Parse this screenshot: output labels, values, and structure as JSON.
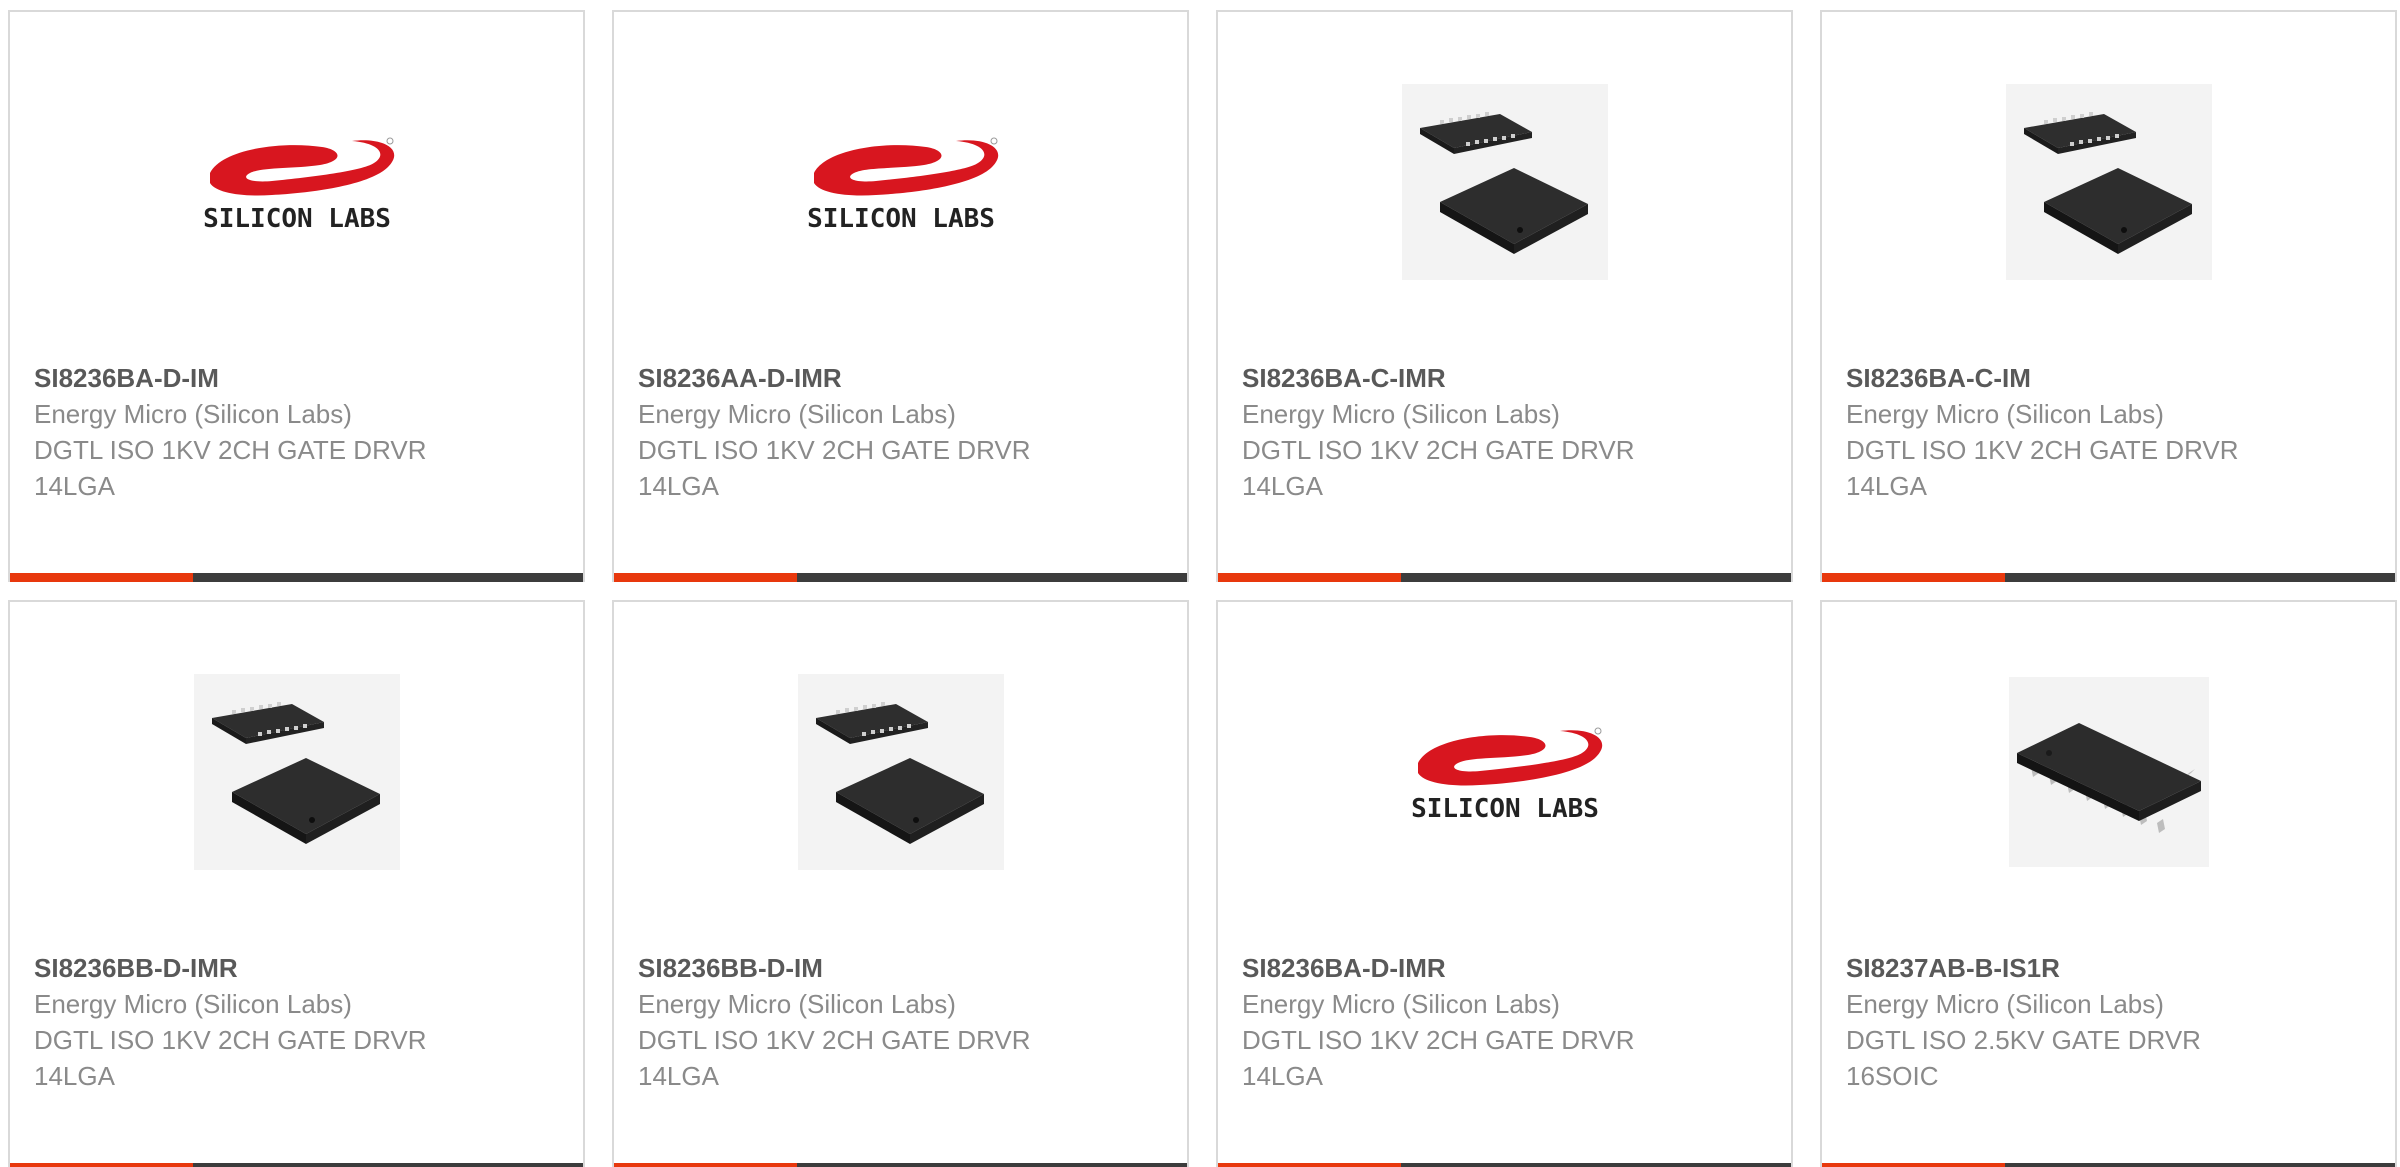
{
  "colors": {
    "accent": "#e8380d",
    "bar": "#3c3c3c",
    "part_text": "#595959",
    "secondary_text": "#8a8a8a",
    "logo_red": "#d8161f"
  },
  "products": [
    {
      "part": "SI8236BA-D-IM",
      "manufacturer": "Energy Micro (Silicon Labs)",
      "description": "DGTL ISO 1KV 2CH GATE DRVR 14LGA",
      "image": "silicon-labs-logo-icon",
      "logo_text": "SILICON LABS"
    },
    {
      "part": "SI8236AA-D-IMR",
      "manufacturer": "Energy Micro (Silicon Labs)",
      "description": "DGTL ISO 1KV 2CH GATE DRVR 14LGA",
      "image": "silicon-labs-logo-icon",
      "logo_text": "SILICON LABS"
    },
    {
      "part": "SI8236BA-C-IMR",
      "manufacturer": "Energy Micro (Silicon Labs)",
      "description": "DGTL ISO 1KV 2CH GATE DRVR 14LGA",
      "image": "lga-chip-icon"
    },
    {
      "part": "SI8236BA-C-IM",
      "manufacturer": "Energy Micro (Silicon Labs)",
      "description": "DGTL ISO 1KV 2CH GATE DRVR 14LGA",
      "image": "lga-chip-icon"
    },
    {
      "part": "SI8236BB-D-IMR",
      "manufacturer": "Energy Micro (Silicon Labs)",
      "description": "DGTL ISO 1KV 2CH GATE DRVR 14LGA",
      "image": "lga-chip-icon"
    },
    {
      "part": "SI8236BB-D-IM",
      "manufacturer": "Energy Micro (Silicon Labs)",
      "description": "DGTL ISO 1KV 2CH GATE DRVR 14LGA",
      "image": "lga-chip-icon"
    },
    {
      "part": "SI8236BA-D-IMR",
      "manufacturer": "Energy Micro (Silicon Labs)",
      "description": "DGTL ISO 1KV 2CH GATE DRVR 14LGA",
      "image": "silicon-labs-logo-icon",
      "logo_text": "SILICON LABS"
    },
    {
      "part": "SI8237AB-B-IS1R",
      "manufacturer": "Energy Micro (Silicon Labs)",
      "description": "DGTL ISO 2.5KV GATE DRVR 16SOIC",
      "image": "soic-chip-icon"
    }
  ]
}
